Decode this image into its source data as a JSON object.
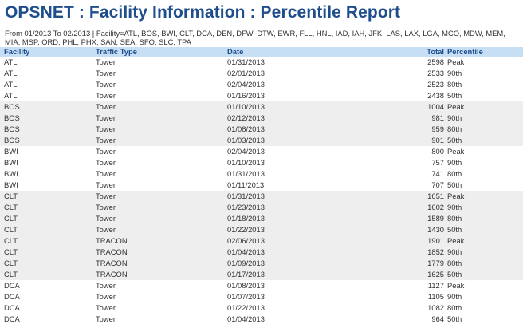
{
  "title": "OPSNET : Facility Information : Percentile Report",
  "criteria": "From 01/2013 To 02/2013 | Facility=ATL, BOS, BWI, CLT, DCA, DEN, DFW, DTW, EWR, FLL, HNL, IAD, IAH, JFK, LAS, LAX, LGA, MCO, MDW, MEM, MIA, MSP, ORD, PHL, PHX, SAN, SEA, SFO, SLC, TPA",
  "columns": {
    "facility": "Facility",
    "traffic_type": "Traffic Type",
    "date": "Date",
    "total": "Total",
    "percentile": "Percentile"
  },
  "rows": [
    {
      "facility": "ATL",
      "traffic_type": "Tower",
      "date": "01/31/2013",
      "total": "2598",
      "percentile": "Peak"
    },
    {
      "facility": "ATL",
      "traffic_type": "Tower",
      "date": "02/01/2013",
      "total": "2533",
      "percentile": "90th"
    },
    {
      "facility": "ATL",
      "traffic_type": "Tower",
      "date": "02/04/2013",
      "total": "2523",
      "percentile": "80th"
    },
    {
      "facility": "ATL",
      "traffic_type": "Tower",
      "date": "01/16/2013",
      "total": "2438",
      "percentile": "50th"
    },
    {
      "facility": "BOS",
      "traffic_type": "Tower",
      "date": "01/10/2013",
      "total": "1004",
      "percentile": "Peak"
    },
    {
      "facility": "BOS",
      "traffic_type": "Tower",
      "date": "02/12/2013",
      "total": "981",
      "percentile": "90th"
    },
    {
      "facility": "BOS",
      "traffic_type": "Tower",
      "date": "01/08/2013",
      "total": "959",
      "percentile": "80th"
    },
    {
      "facility": "BOS",
      "traffic_type": "Tower",
      "date": "01/03/2013",
      "total": "901",
      "percentile": "50th"
    },
    {
      "facility": "BWI",
      "traffic_type": "Tower",
      "date": "02/04/2013",
      "total": "800",
      "percentile": "Peak"
    },
    {
      "facility": "BWI",
      "traffic_type": "Tower",
      "date": "01/10/2013",
      "total": "757",
      "percentile": "90th"
    },
    {
      "facility": "BWI",
      "traffic_type": "Tower",
      "date": "01/31/2013",
      "total": "741",
      "percentile": "80th"
    },
    {
      "facility": "BWI",
      "traffic_type": "Tower",
      "date": "01/11/2013",
      "total": "707",
      "percentile": "50th"
    },
    {
      "facility": "CLT",
      "traffic_type": "Tower",
      "date": "01/31/2013",
      "total": "1651",
      "percentile": "Peak"
    },
    {
      "facility": "CLT",
      "traffic_type": "Tower",
      "date": "01/23/2013",
      "total": "1602",
      "percentile": "90th"
    },
    {
      "facility": "CLT",
      "traffic_type": "Tower",
      "date": "01/18/2013",
      "total": "1589",
      "percentile": "80th"
    },
    {
      "facility": "CLT",
      "traffic_type": "Tower",
      "date": "01/22/2013",
      "total": "1430",
      "percentile": "50th"
    },
    {
      "facility": "CLT",
      "traffic_type": "TRACON",
      "date": "02/06/2013",
      "total": "1901",
      "percentile": "Peak"
    },
    {
      "facility": "CLT",
      "traffic_type": "TRACON",
      "date": "01/04/2013",
      "total": "1852",
      "percentile": "90th"
    },
    {
      "facility": "CLT",
      "traffic_type": "TRACON",
      "date": "01/09/2013",
      "total": "1779",
      "percentile": "80th"
    },
    {
      "facility": "CLT",
      "traffic_type": "TRACON",
      "date": "01/17/2013",
      "total": "1625",
      "percentile": "50th"
    },
    {
      "facility": "DCA",
      "traffic_type": "Tower",
      "date": "01/08/2013",
      "total": "1127",
      "percentile": "Peak"
    },
    {
      "facility": "DCA",
      "traffic_type": "Tower",
      "date": "01/07/2013",
      "total": "1105",
      "percentile": "90th"
    },
    {
      "facility": "DCA",
      "traffic_type": "Tower",
      "date": "01/22/2013",
      "total": "1082",
      "percentile": "80th"
    },
    {
      "facility": "DCA",
      "traffic_type": "Tower",
      "date": "01/04/2013",
      "total": "964",
      "percentile": "50th"
    }
  ],
  "colors": {
    "title": "#1f4e8c",
    "header_bg": "#c7dff5",
    "shaded_row": "#eeeeee"
  }
}
